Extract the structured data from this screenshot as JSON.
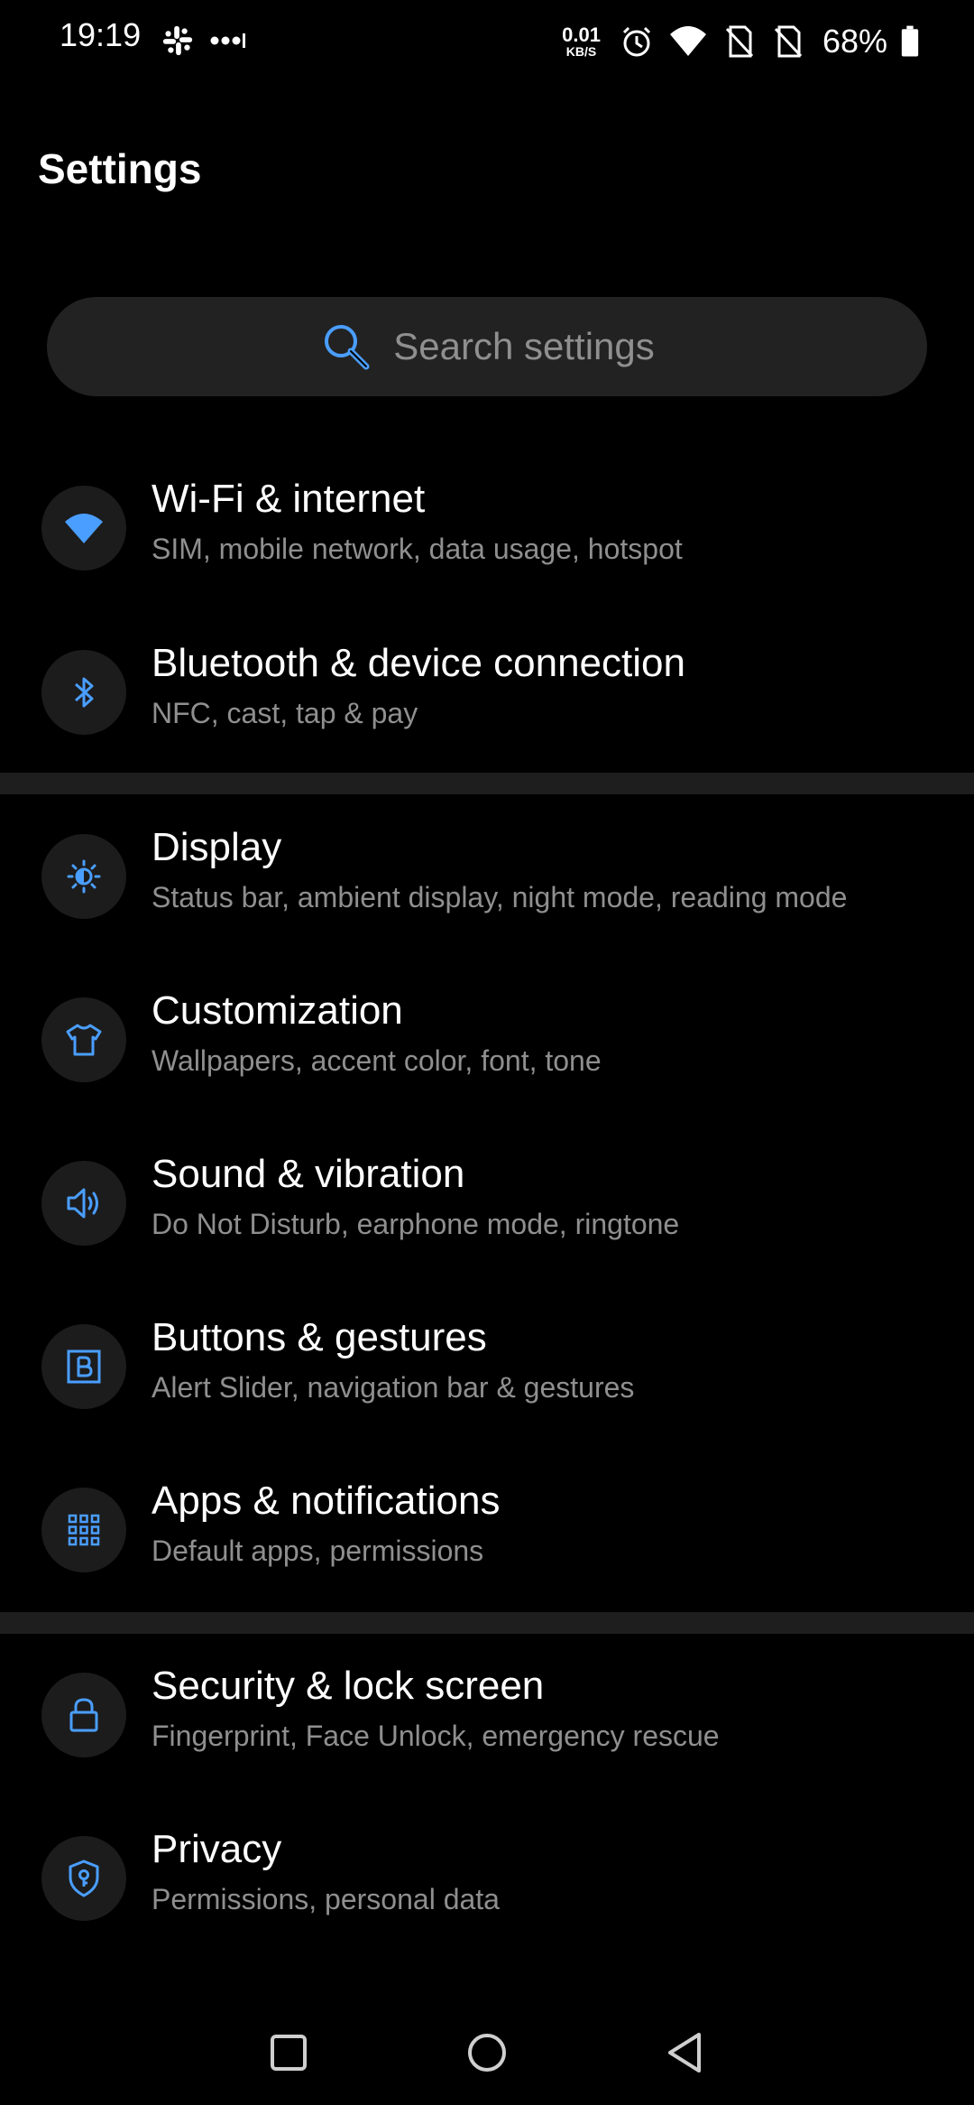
{
  "status_bar": {
    "time": "19:19",
    "net_speed_value": "0.01",
    "net_speed_unit": "KB/S",
    "battery": "68%",
    "icons": [
      "slack-icon",
      "more-dots-icon",
      "alarm-icon",
      "wifi-icon",
      "sim-none-icon",
      "sim-none-icon",
      "battery-icon"
    ]
  },
  "page": {
    "title": "Settings"
  },
  "search": {
    "placeholder": "Search settings",
    "icon": "search-icon"
  },
  "accent_color": "#4a9eff",
  "items": [
    {
      "title": "Wi‑Fi & internet",
      "subtitle": "SIM, mobile network, data usage, hotspot",
      "icon": "wifi-icon"
    },
    {
      "title": "Bluetooth & device connection",
      "subtitle": "NFC, cast, tap & pay",
      "icon": "bluetooth-icon"
    },
    {
      "title": "Display",
      "subtitle": "Status bar, ambient display, night mode, reading mode",
      "icon": "brightness-icon"
    },
    {
      "title": "Customization",
      "subtitle": "Wallpapers, accent color, font, tone",
      "icon": "tshirt-icon"
    },
    {
      "title": "Sound & vibration",
      "subtitle": "Do Not Disturb, earphone mode, ringtone",
      "icon": "speaker-icon"
    },
    {
      "title": "Buttons & gestures",
      "subtitle": "Alert Slider, navigation bar & gestures",
      "icon": "button-b-icon"
    },
    {
      "title": "Apps & notifications",
      "subtitle": "Default apps, permissions",
      "icon": "apps-grid-icon"
    },
    {
      "title": "Security & lock screen",
      "subtitle": "Fingerprint, Face Unlock, emergency rescue",
      "icon": "lock-icon"
    },
    {
      "title": "Privacy",
      "subtitle": "Permissions, personal data",
      "icon": "privacy-shield-icon"
    }
  ],
  "nav_bar": {
    "buttons": [
      "recents-button",
      "home-button",
      "back-button"
    ]
  }
}
